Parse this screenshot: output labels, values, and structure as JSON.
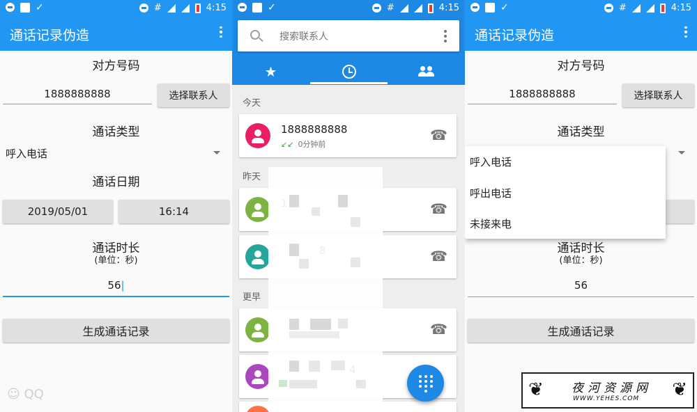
{
  "status_bar": {
    "time": "4:15",
    "network": "LTE"
  },
  "generator": {
    "app_title": "通话记录伪造",
    "phone_label": "对方号码",
    "phone_value": "1888888888",
    "choose_contact": "选择联系人",
    "call_type_label": "通话类型",
    "call_type_value": "呼入电话",
    "call_date_label": "通话日期",
    "date_value": "2019/05/01",
    "time_value": "16:14",
    "duration_label": "通话时长",
    "duration_unit": "(单位：秒)",
    "duration_value": "56",
    "generate_button": "生成通话记录",
    "call_type_options": [
      "呼入电话",
      "呼出电话",
      "未接来电"
    ]
  },
  "dialer": {
    "search_placeholder": "搜索联系人",
    "tabs": [
      "favorites",
      "recents",
      "contacts"
    ],
    "sections": [
      "今天",
      "昨天",
      "更早"
    ],
    "calls": [
      {
        "number": "1888888888",
        "sub": "0分钟前",
        "color": "#e91e63"
      },
      {
        "number": "1",
        "sub": "",
        "color": "#7cb342"
      },
      {
        "number": "8",
        "sub": "",
        "color": "#26a69a"
      },
      {
        "number": "",
        "sub": "",
        "color": "#7cb342"
      },
      {
        "number": "4",
        "sub": "3",
        "color": "#ab47bc"
      }
    ]
  },
  "watermark": {
    "qq": "QQ",
    "site_cn": "夜河资源网",
    "site_en": "WWW.YEHES.COM"
  }
}
